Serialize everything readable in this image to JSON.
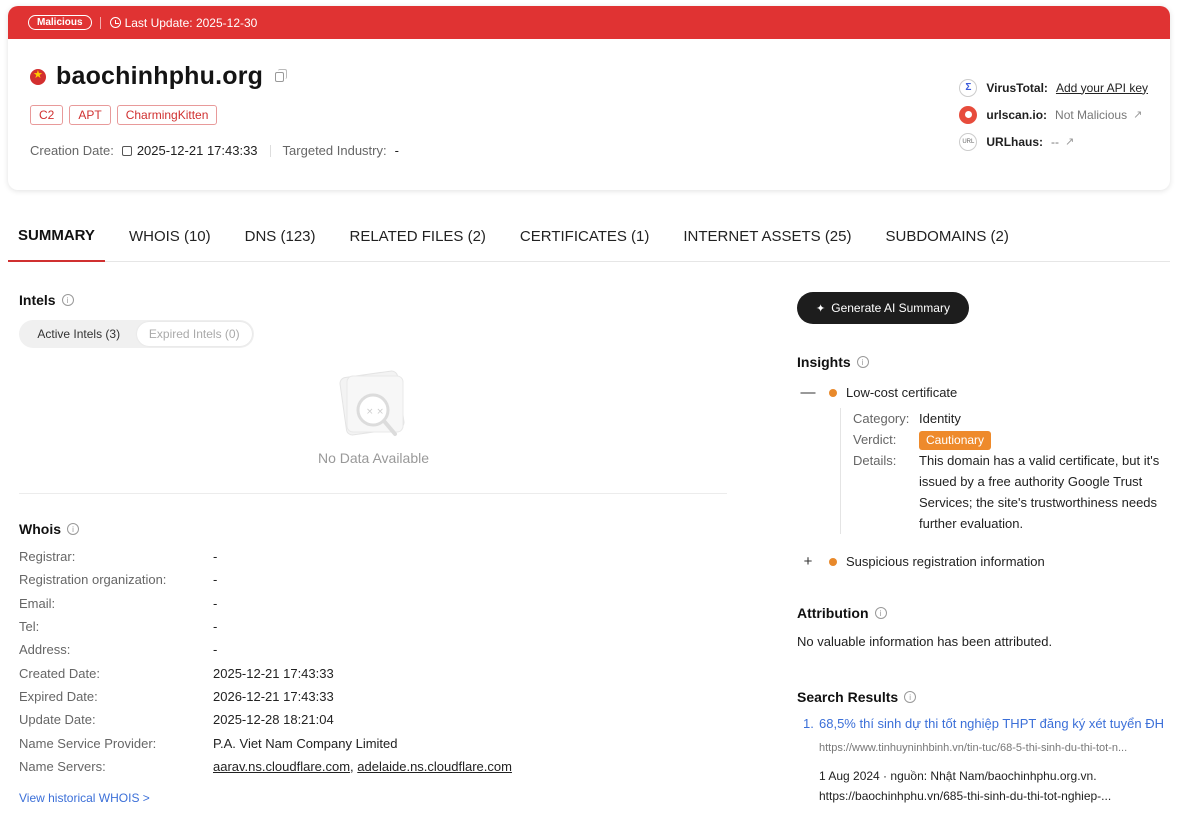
{
  "header": {
    "status_badge": "Malicious",
    "last_update": "Last Update: 2025-12-30",
    "domain": "baochinhphu.org",
    "tags": [
      "C2",
      "APT",
      "CharmingKitten"
    ],
    "creation_date_label": "Creation Date:",
    "creation_date": "2025-12-21 17:43:33",
    "targeted_industry_label": "Targeted Industry:",
    "targeted_industry": "-",
    "external": {
      "virustotal_name": "VirusTotal:",
      "virustotal_value": "Add your API key",
      "urlscan_name": "urlscan.io:",
      "urlscan_value": "Not Malicious",
      "urlhaus_name": "URLhaus:",
      "urlhaus_value": "--"
    }
  },
  "tabs": [
    "SUMMARY",
    "WHOIS (10)",
    "DNS (123)",
    "RELATED FILES (2)",
    "CERTIFICATES (1)",
    "INTERNET ASSETS (25)",
    "SUBDOMAINS (2)"
  ],
  "intels": {
    "title": "Intels",
    "active_label": "Active Intels (3)",
    "expired_label": "Expired Intels (0)",
    "empty_text": "No Data Available"
  },
  "whois": {
    "title": "Whois",
    "rows": [
      {
        "label": "Registrar:",
        "value": "-"
      },
      {
        "label": "Registration organization:",
        "value": "-"
      },
      {
        "label": "Email:",
        "value": "-"
      },
      {
        "label": "Tel:",
        "value": "-"
      },
      {
        "label": "Address:",
        "value": "-"
      },
      {
        "label": "Created Date:",
        "value": "2025-12-21 17:43:33"
      },
      {
        "label": "Expired Date:",
        "value": "2026-12-21 17:43:33"
      },
      {
        "label": "Update Date:",
        "value": "2025-12-28 18:21:04"
      },
      {
        "label": "Name Service Provider:",
        "value": "P.A. Viet Nam Company Limited"
      }
    ],
    "name_servers_label": "Name Servers:",
    "name_server_1": "aarav.ns.cloudflare.com",
    "name_server_sep": ",",
    "name_server_2": "adelaide.ns.cloudflare.com",
    "history_link": "View historical WHOIS >"
  },
  "ai_button": "Generate AI Summary",
  "insights": {
    "title": "Insights",
    "item1_title": "Low-cost certificate",
    "category_label": "Category:",
    "category": "Identity",
    "verdict_label": "Verdict:",
    "verdict": "Cautionary",
    "details_label": "Details:",
    "details": "This domain has a valid certificate, but it's issued by a free authority Google Trust Services; the site's trustworthiness needs further evaluation.",
    "item2_title": "Suspicious registration information"
  },
  "attribution": {
    "title": "Attribution",
    "text": "No valuable information has been attributed."
  },
  "search_results": {
    "title": "Search Results",
    "items": [
      {
        "num": "1.",
        "title": "68,5% thí sinh dự thi tốt nghiệp THPT đăng ký xét tuyển ĐH",
        "url": "https://www.tinhuyninhbinh.vn/tin-tuc/68-5-thi-sinh-du-thi-tot-n...",
        "meta": "1 Aug 2024 · nguồn: Nhật Nam/baochinhphu.org.vn. https://baochinhphu.vn/685-thi-sinh-du-thi-tot-nghiep-..."
      }
    ]
  },
  "colors": {
    "malicious_red": "#e03333",
    "accent_orange": "#ee8a2b",
    "link_blue": "#3b6fd8"
  }
}
